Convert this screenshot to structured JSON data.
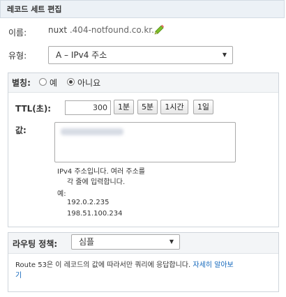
{
  "header": {
    "title": "레코드 세트 편집"
  },
  "name": {
    "label": "이름:",
    "value": "nuxt",
    "suffix": ".404-notfound.co.kr.",
    "edit_icon": "pencil-icon"
  },
  "type": {
    "label": "유형:",
    "selected": "A – IPv4 주소"
  },
  "alias": {
    "label": "별칭:",
    "yes": "예",
    "no": "아니요",
    "selected": "no"
  },
  "ttl": {
    "label": "TTL(초):",
    "value": "300",
    "presets": [
      "1분",
      "5분",
      "1시간",
      "1일"
    ]
  },
  "value": {
    "label": "값:",
    "help_line1": "IPv4 주소입니다. 여러 주소를",
    "help_line2": "각 줄에 입력합니다.",
    "example_label": "예:",
    "example1": "192.0.2.235",
    "example2": "198.51.100.234"
  },
  "routing": {
    "label": "라우팅 정책:",
    "selected": "심플",
    "desc": "Route 53은 이 레코드의 값에 따라서만 쿼리에 응답합니다.",
    "link_part1": "자세히 알아보",
    "link_part2": "기"
  },
  "colors": {
    "link": "#1166bb",
    "header_bg": "#ecf1f6",
    "pencil": "#7fbf2a"
  }
}
